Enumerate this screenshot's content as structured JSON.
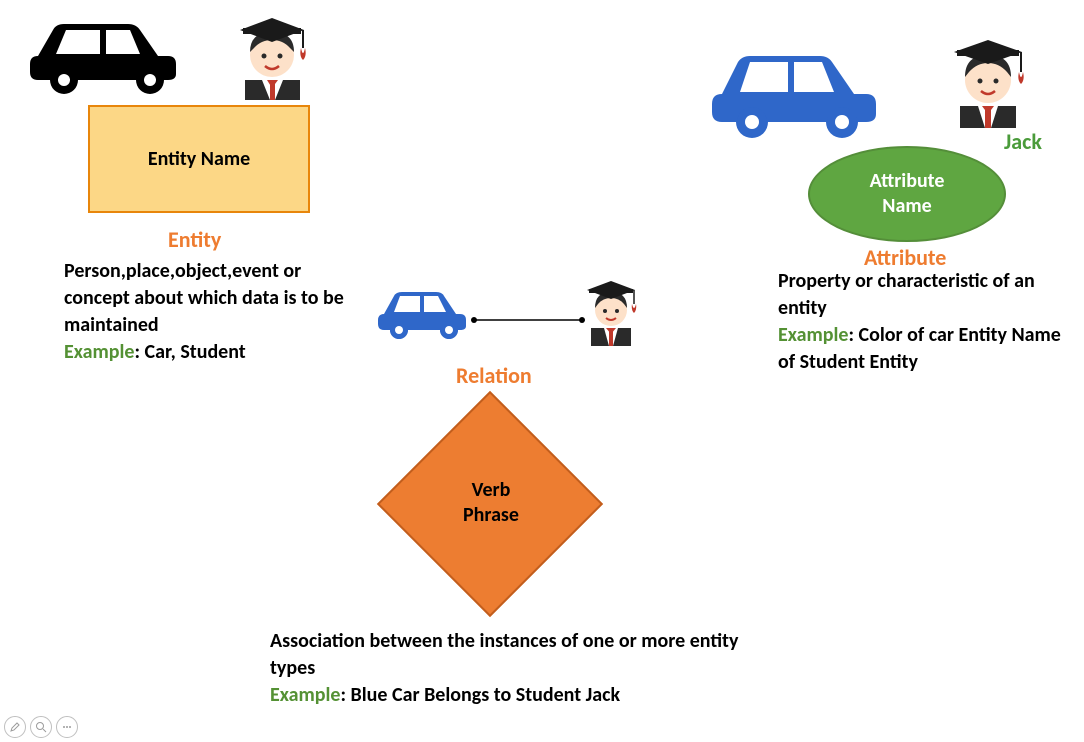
{
  "entity": {
    "shape_label": "Entity Name",
    "title": "Entity",
    "description": "Person,place,object,event or concept about which data is to be maintained",
    "example_label": "Example",
    "example_text": ": Car, Student"
  },
  "relation": {
    "shape_label_line1": "Verb",
    "shape_label_line2": "Phrase",
    "title": "Relation",
    "description": "Association between the instances of one or more entity types",
    "example_label": "Example",
    "example_text": ": Blue Car Belongs to Student Jack"
  },
  "attribute": {
    "shape_label_line1": "Attribute",
    "shape_label_line2": "Name",
    "title": "Attribute",
    "jack_label": "Jack",
    "description": "Property or characteristic of an entity",
    "example_label": "Example",
    "example_text": ": Color of car Entity Name of Student Entity"
  }
}
